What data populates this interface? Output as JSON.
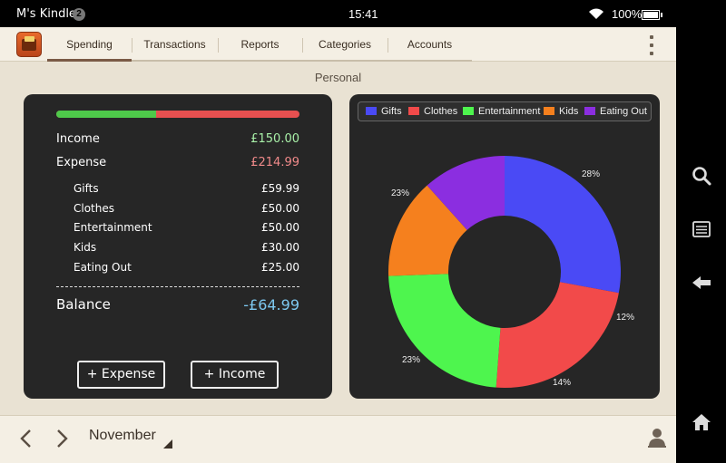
{
  "status_bar": {
    "device_name": "M's Kindle",
    "notification_count": "2",
    "time": "15:41",
    "battery_percent": "100%"
  },
  "tabs": [
    {
      "label": "Spending",
      "active": true
    },
    {
      "label": "Transactions",
      "active": false
    },
    {
      "label": "Reports",
      "active": false
    },
    {
      "label": "Categories",
      "active": false
    },
    {
      "label": "Accounts",
      "active": false
    }
  ],
  "account_title": "Personal",
  "summary": {
    "income_label": "Income",
    "income_value": "£150.00",
    "expense_label": "Expense",
    "expense_value": "£214.99",
    "progress_income_fraction": 0.41,
    "categories": [
      {
        "label": "Gifts",
        "value": "£59.99"
      },
      {
        "label": "Clothes",
        "value": "£50.00"
      },
      {
        "label": "Entertainment",
        "value": "£50.00"
      },
      {
        "label": "Kids",
        "value": "£30.00"
      },
      {
        "label": "Eating Out",
        "value": "£25.00"
      }
    ],
    "balance_label": "Balance",
    "balance_value": "-£64.99",
    "add_expense_label": "+ Expense",
    "add_income_label": "+ Income"
  },
  "chart_data": {
    "type": "pie",
    "donut": true,
    "legend_position": "top",
    "categories": [
      "Gifts",
      "Clothes",
      "Entertainment",
      "Kids",
      "Eating Out"
    ],
    "values": [
      59.99,
      50.0,
      50.0,
      30.0,
      25.0
    ],
    "percent_labels": [
      "28%",
      "23%",
      "23%",
      "14%",
      "12%"
    ],
    "colors": [
      "#4a4af5",
      "#f24a4a",
      "#4ef54e",
      "#f5801e",
      "#8b2ee0"
    ]
  },
  "bottom_bar": {
    "month": "November"
  },
  "icons": {
    "nav_prev": "chevron-left-icon",
    "nav_next": "chevron-right-icon",
    "user": "user-icon",
    "search": "search-icon",
    "menu": "notes-icon",
    "back": "back-arrow-icon",
    "home": "home-icon"
  }
}
